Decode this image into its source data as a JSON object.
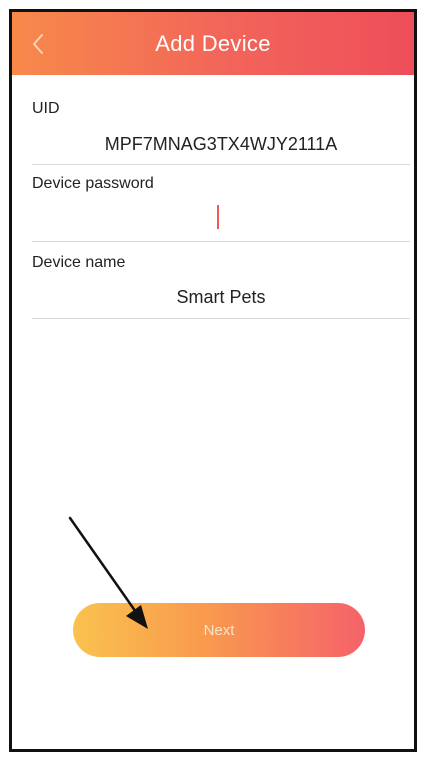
{
  "header": {
    "title": "Add Device",
    "back_icon": "chevron-left-icon"
  },
  "form": {
    "uid": {
      "label": "UID",
      "value": "MPF7MNAG3TX4WJY2111A"
    },
    "password": {
      "label": "Device password",
      "value": ""
    },
    "name": {
      "label": "Device name",
      "value": "Smart Pets"
    }
  },
  "actions": {
    "next_label": "Next"
  },
  "colors": {
    "header_start": "#f7894a",
    "header_end": "#ee4e5a",
    "button_start": "#f9c24e",
    "button_end": "#f5626a",
    "caret": "#f05a5a"
  }
}
